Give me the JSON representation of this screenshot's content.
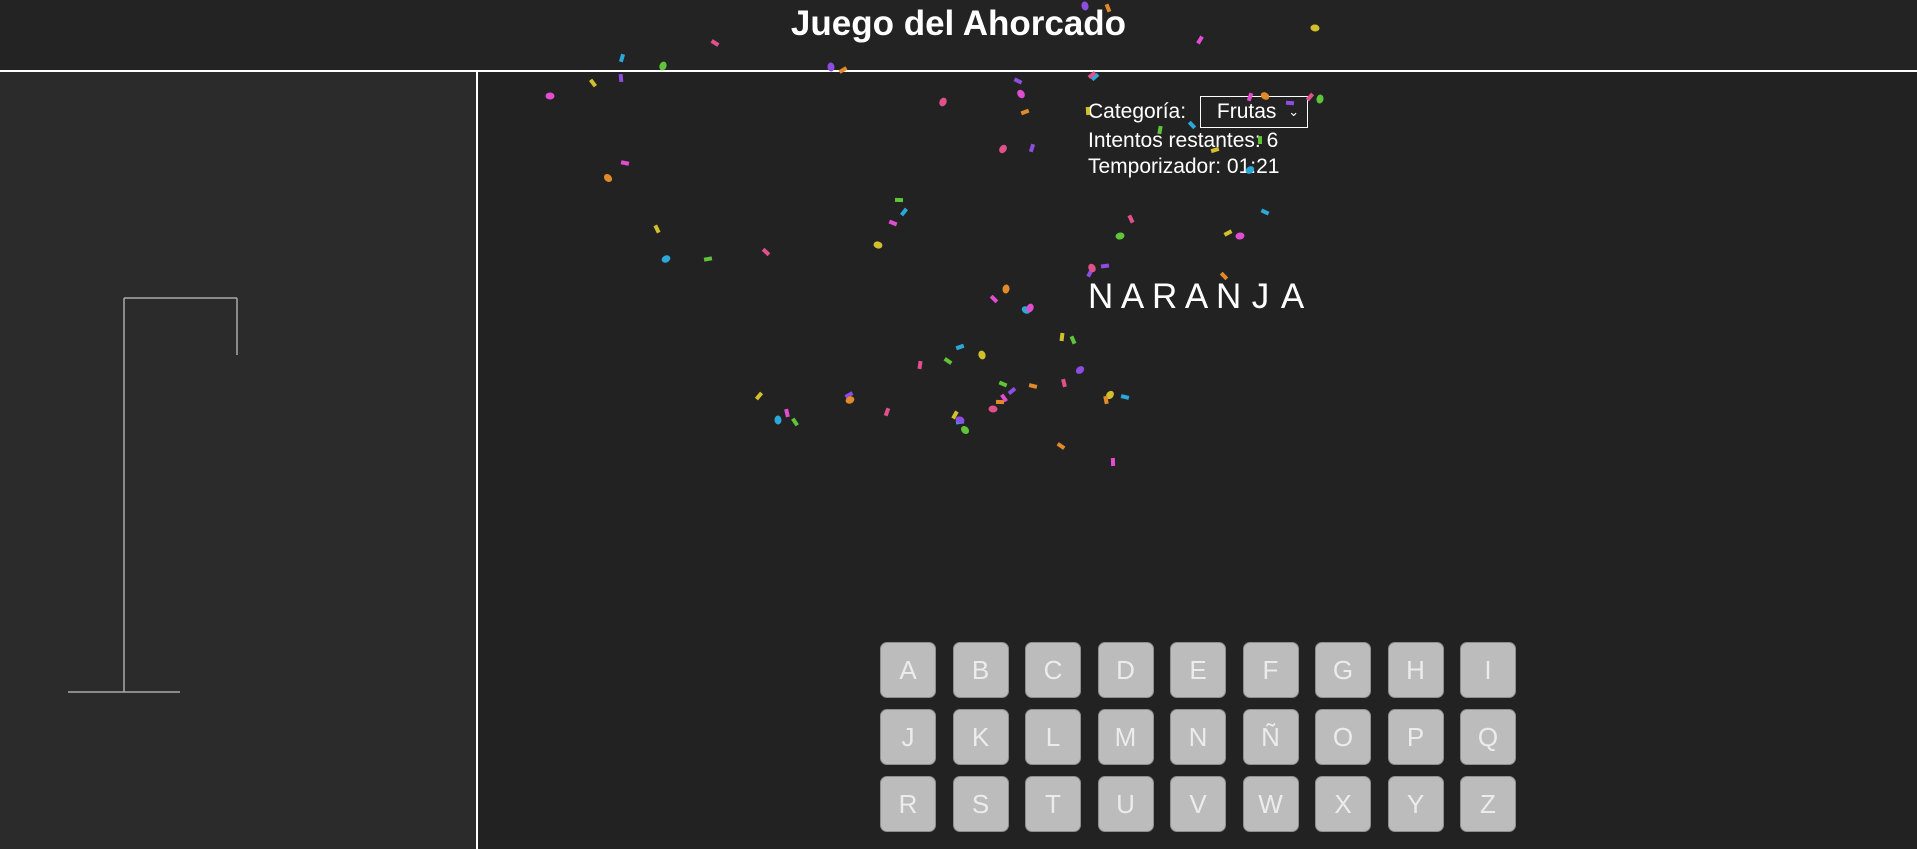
{
  "header": {
    "title": "Juego del Ahorcado"
  },
  "game": {
    "category_label": "Categoría:",
    "category_value": "Frutas",
    "attempts_text": "Intentos restantes: 6",
    "timer_text": "Temporizador: 01:21",
    "word": [
      "N",
      "A",
      "R",
      "A",
      "N",
      "J",
      "A"
    ]
  },
  "keyboard": {
    "keys": [
      "A",
      "B",
      "C",
      "D",
      "E",
      "F",
      "G",
      "H",
      "I",
      "J",
      "K",
      "L",
      "M",
      "N",
      "Ñ",
      "O",
      "P",
      "Q",
      "R",
      "S",
      "T",
      "U",
      "V",
      "W",
      "X",
      "Y",
      "Z"
    ]
  },
  "colors": {
    "background": "#222222",
    "left_panel": "#2b2b2b",
    "key_bg": "#bcbcbc",
    "confetti": [
      "#e04dd0",
      "#d1c02c",
      "#2aa8d8",
      "#5fc43a",
      "#e0508a",
      "#8d4de0",
      "#e08a2a"
    ]
  }
}
